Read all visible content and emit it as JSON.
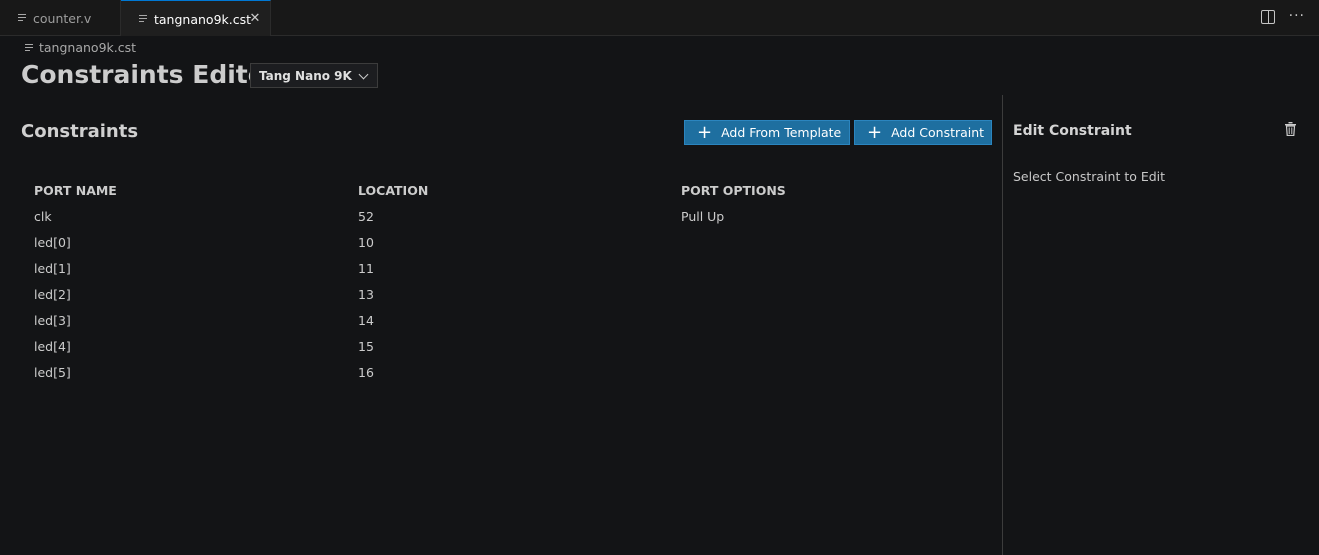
{
  "tabs": [
    {
      "label": "counter.v",
      "active": false
    },
    {
      "label": "tangnano9k.cst",
      "active": true
    }
  ],
  "breadcrumb": "tangnano9k.cst",
  "editor": {
    "title": "Constraints Editor",
    "board_select": "Tang Nano 9K"
  },
  "constraints": {
    "title": "Constraints",
    "add_template_label": "Add From Template",
    "add_constraint_label": "Add Constraint",
    "columns": [
      "PORT NAME",
      "LOCATION",
      "PORT OPTIONS"
    ],
    "rows": [
      {
        "port": "clk",
        "location": "52",
        "options": "Pull Up"
      },
      {
        "port": "led[0]",
        "location": "10",
        "options": ""
      },
      {
        "port": "led[1]",
        "location": "11",
        "options": ""
      },
      {
        "port": "led[2]",
        "location": "13",
        "options": ""
      },
      {
        "port": "led[3]",
        "location": "14",
        "options": ""
      },
      {
        "port": "led[4]",
        "location": "15",
        "options": ""
      },
      {
        "port": "led[5]",
        "location": "16",
        "options": ""
      }
    ]
  },
  "edit_panel": {
    "title": "Edit Constraint",
    "hint": "Select Constraint to Edit"
  },
  "colors": {
    "background": "#131416",
    "button": "#1e6fa0",
    "active_tab_border": "#0078d4"
  }
}
